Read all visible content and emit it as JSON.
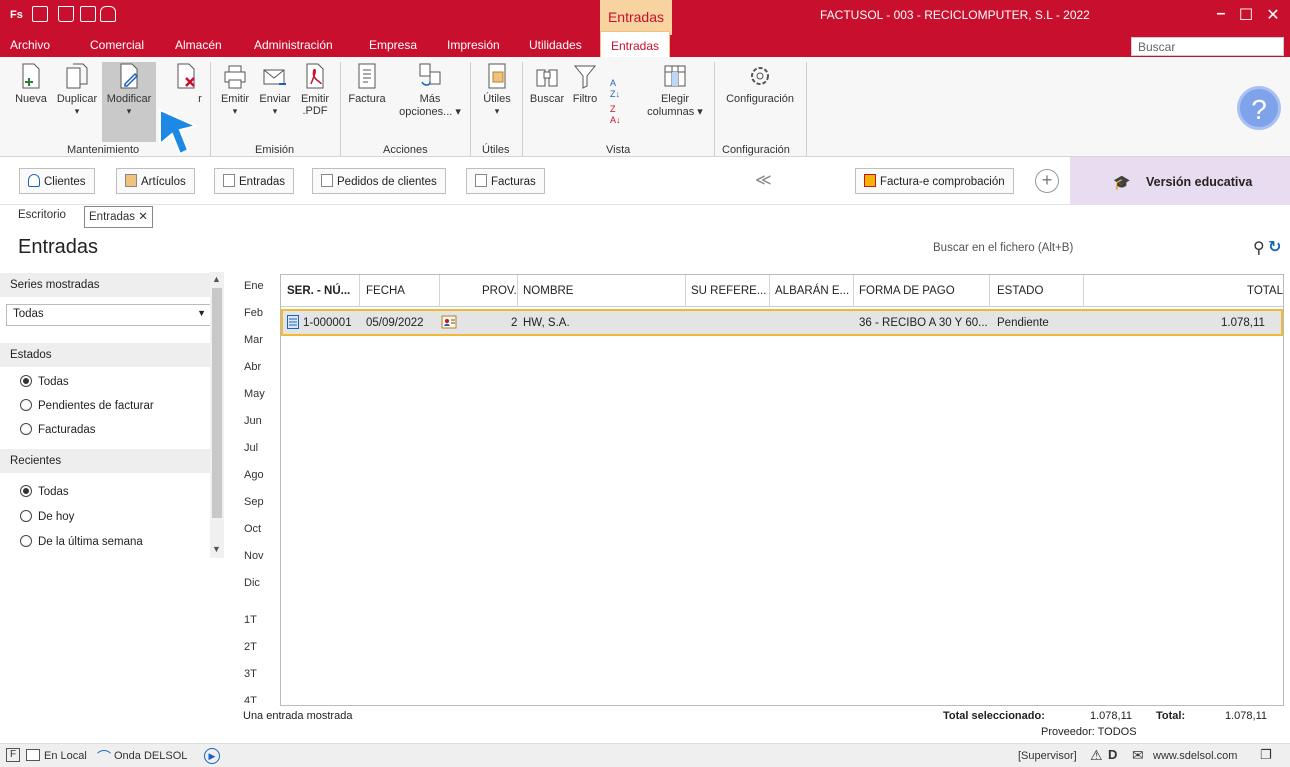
{
  "titlebar": {
    "app_logo": "Fs",
    "context_tab": "Entradas",
    "title": "FACTUSOL - 003 - RECICLOMPUTER, S.L - 2022",
    "minimize": "–",
    "maximize": "☐",
    "close": "✕"
  },
  "menu": {
    "items": [
      "Archivo",
      "Comercial",
      "Almacén",
      "Administración",
      "Empresa",
      "Impresión",
      "Utilidades",
      "Entradas"
    ],
    "search_placeholder": "Buscar"
  },
  "ribbon": {
    "buttons": {
      "nueva": "Nueva",
      "duplicar": "Duplicar",
      "modificar": "Modificar",
      "eliminar": "r",
      "emitir": "Emitir",
      "enviar": "Enviar",
      "emitir_pdf_1": "Emitir",
      "emitir_pdf_2": ".PDF",
      "factura": "Factura",
      "mas_1": "Más",
      "mas_2": "opciones... ▾",
      "utiles": "Útiles",
      "buscar": "Buscar",
      "filtro": "Filtro",
      "elegir_1": "Elegir",
      "elegir_2": "columnas ▾",
      "configuracion": "Configuración"
    },
    "groups": [
      "Mantenimiento",
      "Emisión",
      "Acciones",
      "Útiles",
      "Vista",
      "Configuración"
    ]
  },
  "shortcuts": {
    "clientes": "Clientes",
    "articulos": "Artículos",
    "entradas": "Entradas",
    "pedidos": "Pedidos de clientes",
    "facturas": "Facturas",
    "chevron": "≪",
    "factura_e": "Factura-e comprobación",
    "version": "Versión educativa"
  },
  "doctabs": {
    "escritorio": "Escritorio",
    "entradas": "Entradas",
    "close": "✕"
  },
  "page": {
    "title": "Entradas",
    "file_search": "Buscar en el fichero (Alt+B)"
  },
  "filters": {
    "series_head": "Series mostradas",
    "series_value": "Todas",
    "estados_head": "Estados",
    "estados": [
      {
        "label": "Todas",
        "checked": true
      },
      {
        "label": "Pendientes de facturar",
        "checked": false
      },
      {
        "label": "Facturadas",
        "checked": false
      }
    ],
    "recientes_head": "Recientes",
    "recientes": [
      {
        "label": "Todas",
        "checked": true
      },
      {
        "label": "De hoy",
        "checked": false
      },
      {
        "label": "De la última semana",
        "checked": false
      }
    ]
  },
  "months": [
    "Ene",
    "Feb",
    "Mar",
    "Abr",
    "May",
    "Jun",
    "Jul",
    "Ago",
    "Sep",
    "Oct",
    "Nov",
    "Dic",
    "1T",
    "2T",
    "3T",
    "4T"
  ],
  "grid": {
    "columns": [
      "SER. - NÚ...",
      "FECHA",
      "PROV.",
      "NOMBRE",
      "SU REFERE...",
      "ALBARÁN E...",
      "FORMA DE PAGO",
      "ESTADO",
      "TOTAL"
    ],
    "rows": [
      {
        "numero": "1-000001",
        "fecha": "05/09/2022",
        "prov": "2",
        "nombre": "HW, S.A.",
        "su_ref": "",
        "albaran": "",
        "forma_pago": "36 - RECIBO A 30 Y 60...",
        "estado": "Pendiente",
        "total": "1.078,11"
      }
    ]
  },
  "footer": {
    "count": "Una entrada mostrada",
    "total_sel_label": "Total seleccionado:",
    "total_sel_value": "1.078,11",
    "total_label": "Total:",
    "total_value": "1.078,11",
    "proveedor": "Proveedor: TODOS"
  },
  "status": {
    "local": "En Local",
    "onda": "Onda DELSOL",
    "supervisor": "[Supervisor]",
    "website": "www.sdelsol.com"
  },
  "colors": {
    "brand": "#c8102e",
    "selection_border": "#f0b93a",
    "edu_bg": "#e8ddf0"
  }
}
